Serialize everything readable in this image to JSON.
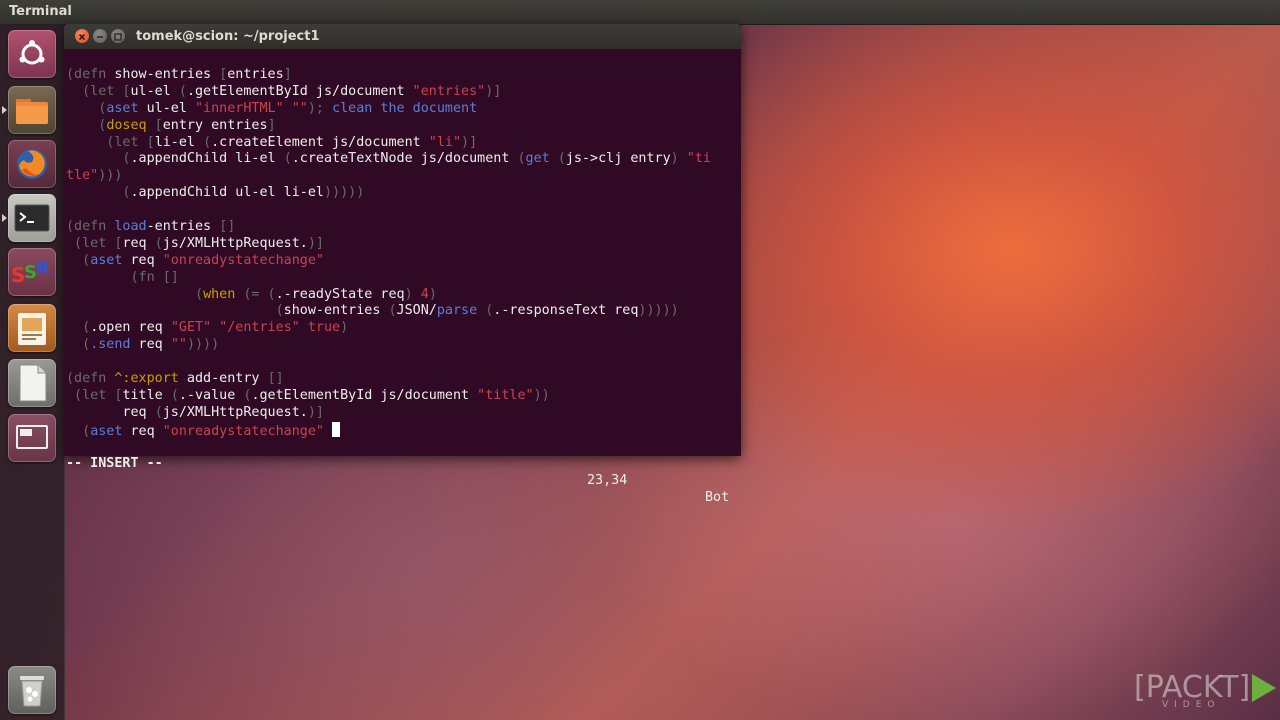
{
  "topbar": {
    "app_name": "Terminal"
  },
  "window": {
    "title": "tomek@scion: ~/project1"
  },
  "launcher": {
    "items": [
      {
        "name": "Dash home",
        "icon": "ubuntu-logo-icon"
      },
      {
        "name": "Files",
        "icon": "folder-icon"
      },
      {
        "name": "Firefox",
        "icon": "firefox-icon"
      },
      {
        "name": "Terminal",
        "icon": "terminal-icon"
      },
      {
        "name": "SSR",
        "icon": "ssr-icon",
        "label": "SSR"
      },
      {
        "name": "Impress",
        "icon": "presentation-icon"
      },
      {
        "name": "Document",
        "icon": "document-icon"
      },
      {
        "name": "Workspaces",
        "icon": "workspace-switcher-icon"
      },
      {
        "name": "Trash",
        "icon": "trash-icon"
      }
    ]
  },
  "editor": {
    "lines": [
      [
        {
          "t": "(defn ",
          "c": "g"
        },
        {
          "t": "show-entries ",
          "c": "w"
        },
        {
          "t": "[",
          "c": "g"
        },
        {
          "t": "entries",
          "c": "w"
        },
        {
          "t": "]",
          "c": "g"
        }
      ],
      [
        {
          "t": "  (let [",
          "c": "g"
        },
        {
          "t": "ul-el ",
          "c": "w"
        },
        {
          "t": "(",
          "c": "g"
        },
        {
          "t": ".getElementById js/document ",
          "c": "w"
        },
        {
          "t": "\"entries\"",
          "c": "r"
        },
        {
          "t": ")]",
          "c": "g"
        }
      ],
      [
        {
          "t": "    (",
          "c": "g"
        },
        {
          "t": "aset",
          "c": "b"
        },
        {
          "t": " ul-el ",
          "c": "w"
        },
        {
          "t": "\"innerHTML\" \"\"",
          "c": "r"
        },
        {
          "t": "); ",
          "c": "g"
        },
        {
          "t": "clean the document",
          "c": "b"
        }
      ],
      [
        {
          "t": "    (",
          "c": "g"
        },
        {
          "t": "doseq",
          "c": "y"
        },
        {
          "t": " [",
          "c": "g"
        },
        {
          "t": "entry entries",
          "c": "w"
        },
        {
          "t": "]",
          "c": "g"
        }
      ],
      [
        {
          "t": "     (let [",
          "c": "g"
        },
        {
          "t": "li-el ",
          "c": "w"
        },
        {
          "t": "(",
          "c": "g"
        },
        {
          "t": ".createElement js/document ",
          "c": "w"
        },
        {
          "t": "\"li\"",
          "c": "r"
        },
        {
          "t": ")]",
          "c": "g"
        }
      ],
      [
        {
          "t": "       (",
          "c": "g"
        },
        {
          "t": ".appendChild li-el ",
          "c": "w"
        },
        {
          "t": "(",
          "c": "g"
        },
        {
          "t": ".createTextNode js/document ",
          "c": "w"
        },
        {
          "t": "(",
          "c": "g"
        },
        {
          "t": "get",
          "c": "b"
        },
        {
          "t": " (",
          "c": "g"
        },
        {
          "t": "js->clj entry",
          "c": "w"
        },
        {
          "t": ") ",
          "c": "g"
        },
        {
          "t": "\"ti",
          "c": "r"
        }
      ],
      [
        {
          "t": "tle\"",
          "c": "r"
        },
        {
          "t": ")))",
          "c": "g"
        }
      ],
      [
        {
          "t": "       (",
          "c": "g"
        },
        {
          "t": ".appendChild ul-el li-el",
          "c": "w"
        },
        {
          "t": ")))))",
          "c": "g"
        }
      ],
      [],
      [
        {
          "t": "(defn ",
          "c": "g"
        },
        {
          "t": "load",
          "c": "b"
        },
        {
          "t": "-entries ",
          "c": "w"
        },
        {
          "t": "[]",
          "c": "g"
        }
      ],
      [
        {
          "t": " (let [",
          "c": "g"
        },
        {
          "t": "req ",
          "c": "w"
        },
        {
          "t": "(",
          "c": "g"
        },
        {
          "t": "js/XMLHttpRequest.",
          "c": "w"
        },
        {
          "t": ")]",
          "c": "g"
        }
      ],
      [
        {
          "t": "  (",
          "c": "g"
        },
        {
          "t": "aset",
          "c": "b"
        },
        {
          "t": " req ",
          "c": "w"
        },
        {
          "t": "\"onreadystatechange\"",
          "c": "r"
        }
      ],
      [
        {
          "t": "        (fn []",
          "c": "g"
        }
      ],
      [
        {
          "t": "                (",
          "c": "g"
        },
        {
          "t": "when",
          "c": "y"
        },
        {
          "t": " (= (",
          "c": "g"
        },
        {
          "t": ".-readyState req",
          "c": "w"
        },
        {
          "t": ") ",
          "c": "g"
        },
        {
          "t": "4",
          "c": "r"
        },
        {
          "t": ")",
          "c": "g"
        }
      ],
      [
        {
          "t": "                          (",
          "c": "g"
        },
        {
          "t": "show-entries ",
          "c": "w"
        },
        {
          "t": "(",
          "c": "g"
        },
        {
          "t": "JSON/",
          "c": "w"
        },
        {
          "t": "parse",
          "c": "b"
        },
        {
          "t": " (",
          "c": "g"
        },
        {
          "t": ".-responseText req",
          "c": "w"
        },
        {
          "t": ")))))",
          "c": "g"
        }
      ],
      [
        {
          "t": "  (",
          "c": "g"
        },
        {
          "t": ".open req ",
          "c": "w"
        },
        {
          "t": "\"GET\" \"/entries\" true",
          "c": "r"
        },
        {
          "t": ")",
          "c": "g"
        }
      ],
      [
        {
          "t": "  (",
          "c": "g"
        },
        {
          "t": ".send",
          "c": "b"
        },
        {
          "t": " req ",
          "c": "w"
        },
        {
          "t": "\"\"",
          "c": "r"
        },
        {
          "t": "))))",
          "c": "g"
        }
      ],
      [],
      [
        {
          "t": "(defn ",
          "c": "g"
        },
        {
          "t": "^:export",
          "c": "y"
        },
        {
          "t": " add-entry ",
          "c": "w"
        },
        {
          "t": "[]",
          "c": "g"
        }
      ],
      [
        {
          "t": " (let [",
          "c": "g"
        },
        {
          "t": "title ",
          "c": "w"
        },
        {
          "t": "(",
          "c": "g"
        },
        {
          "t": ".-value ",
          "c": "w"
        },
        {
          "t": "(",
          "c": "g"
        },
        {
          "t": ".getElementById js/document ",
          "c": "w"
        },
        {
          "t": "\"title\"",
          "c": "r"
        },
        {
          "t": "))",
          "c": "g"
        }
      ],
      [
        {
          "t": "       ",
          "c": "g"
        },
        {
          "t": "req ",
          "c": "w"
        },
        {
          "t": "(",
          "c": "g"
        },
        {
          "t": "js/XMLHttpRequest.",
          "c": "w"
        },
        {
          "t": ")]",
          "c": "g"
        }
      ],
      [
        {
          "t": "  (",
          "c": "g"
        },
        {
          "t": "aset",
          "c": "b"
        },
        {
          "t": " req ",
          "c": "w"
        },
        {
          "t": "\"onreadystatechange\"",
          "c": "r"
        },
        {
          "t": " ",
          "c": "w"
        }
      ]
    ],
    "status": {
      "mode": "-- INSERT --",
      "position": "23,34",
      "scroll": "Bot"
    }
  },
  "watermark": {
    "brand": "[PACKT]",
    "sub": "VIDEO"
  },
  "colors": {
    "terminal_bg": "#300a24",
    "string": "#c9434f",
    "keyword": "#5a7fd8",
    "macro": "#c4a000",
    "paren": "#6a6a6a"
  }
}
